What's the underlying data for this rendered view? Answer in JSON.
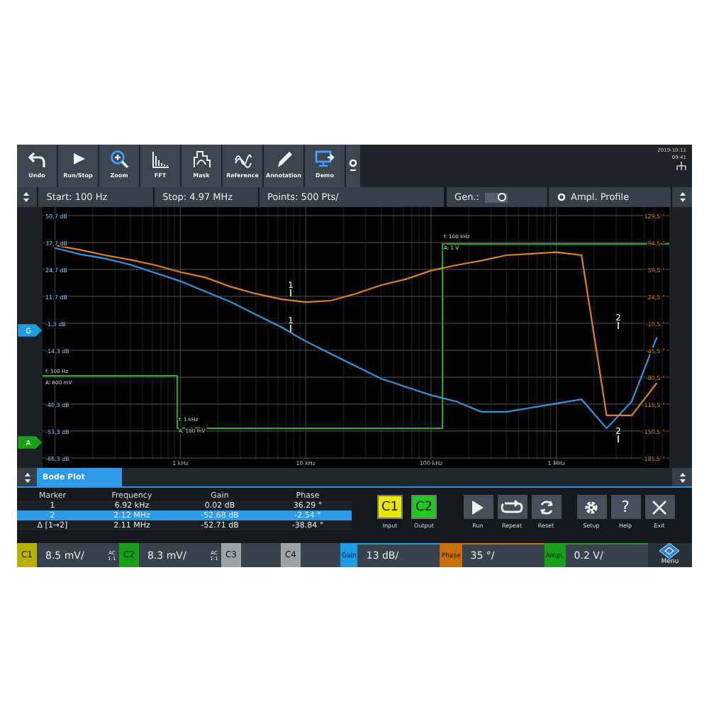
{
  "toolbar": {
    "buttons": [
      {
        "label": "Undo",
        "kind": "undo"
      },
      {
        "label": "Run/Stop",
        "kind": "play"
      },
      {
        "label": "Zoom",
        "kind": "zoom"
      },
      {
        "label": "FFT",
        "kind": "fft"
      },
      {
        "label": "Mask",
        "kind": "mask"
      },
      {
        "label": "Reference",
        "kind": "reference"
      },
      {
        "label": "Annotation",
        "kind": "pencil"
      },
      {
        "label": "Demo",
        "kind": "demo"
      }
    ],
    "date": "2019-10-11",
    "time": "09:41"
  },
  "sweep": {
    "start": "Start: 100 Hz",
    "stop": "Stop: 4.97 MHz",
    "points": "Points: 500 Pts/",
    "generator": {
      "label": "Gen.:",
      "on": true
    },
    "profile": {
      "label": "Ampl. Profile"
    }
  },
  "plot": {
    "chart_data": {
      "type": "line",
      "grid": true,
      "categories": [
        null,
        null,
        null,
        null,
        null,
        "1 kHz",
        null,
        null,
        null,
        null,
        "10 kHz",
        null,
        null,
        null,
        null,
        "100 kHz",
        null,
        null,
        null,
        null,
        "1 MHz",
        null,
        null,
        null,
        null
      ],
      "ylim": [
        -66.3,
        50.7
      ],
      "yticks": [
        {
          "value": 50.7,
          "label": "50,7 dB"
        },
        {
          "value": 37.7,
          "label": "37,7 dB"
        },
        {
          "value": 24.7,
          "label": "24,7 dB"
        },
        {
          "value": 11.7,
          "label": "11,7 dB"
        },
        {
          "value": -1.3,
          "label": "-1,3 dB"
        },
        {
          "value": -14.3,
          "label": "-14,3 dB"
        },
        {
          "value": -40.3,
          "label": "-40,3 dB"
        },
        {
          "value": -53.3,
          "label": "-53,3 dB"
        },
        {
          "value": -66.3,
          "label": "-66,3 dB"
        }
      ],
      "y2lim": [
        -185.5,
        129.5
      ],
      "y2ticks": [
        {
          "value": 129.5,
          "label": "129,5 °"
        },
        {
          "value": 94.5,
          "label": "94,5 °"
        },
        {
          "value": 59.5,
          "label": "59,5 °"
        },
        {
          "value": 24.5,
          "label": "24,5 °"
        },
        {
          "value": -10.5,
          "label": "-10,5 °"
        },
        {
          "value": -45.5,
          "label": "-45,5 °"
        },
        {
          "value": -80.5,
          "label": "-80,5 °"
        },
        {
          "value": -115.5,
          "label": "-115,5 °"
        },
        {
          "value": -150.5,
          "label": "-150,5 °"
        },
        {
          "value": -185.5,
          "label": "-185,5 °"
        }
      ],
      "series": [
        {
          "color": "#2a98e0",
          "values": [
            35,
            32,
            30,
            27,
            23,
            19,
            14,
            9,
            3,
            -3,
            -10,
            -16,
            -22,
            -28,
            -32,
            -36,
            -39,
            -44,
            -44,
            -42,
            -40,
            -38,
            -52,
            -39,
            -8
          ]
        },
        {
          "color": "#e0801c",
          "axis": "y2",
          "values": [
            91,
            85,
            78,
            72,
            65,
            56,
            49,
            37,
            28,
            21,
            17,
            19,
            28,
            39,
            47,
            58,
            65,
            71,
            78,
            80,
            82,
            78,
            -130,
            -130,
            -88
          ]
        }
      ]
    },
    "profile_labels": [
      {
        "lines": [
          "f: 100 Hz",
          "A: 600 mV"
        ]
      },
      {
        "lines": [
          "f: 1 kHz",
          "A: 100 mV"
        ]
      },
      {
        "lines": [
          "f: 100 kHz",
          "A: 1 V"
        ]
      }
    ],
    "markers": [
      {
        "label": "1"
      },
      {
        "label": "1"
      },
      {
        "label": "2"
      },
      {
        "label": "2"
      }
    ],
    "tags": [
      {
        "label": "G",
        "color": "#1e9be0"
      },
      {
        "label": "A",
        "color": "#19a019"
      }
    ]
  },
  "panel": {
    "tab": {
      "label": "Bode Plot",
      "selected": true
    },
    "table": {
      "columns": [
        "Marker",
        "Frequency",
        "Gain",
        "Phase"
      ],
      "rows": [
        {
          "cells": [
            "1",
            "6.92 kHz",
            "0.02 dB",
            "36.29 °"
          ],
          "selected": false
        },
        {
          "cells": [
            "2",
            "2.12 MHz",
            "-52.68 dB",
            "-2.54 °"
          ],
          "selected": true
        },
        {
          "cells": [
            "Δ [1→2]",
            "2.11 MHz",
            "-52.71 dB",
            "-38.84 °"
          ],
          "selected": false
        }
      ]
    },
    "buttons": [
      {
        "kind": "channel",
        "chip": "C1",
        "label": "Input",
        "color": "#e8e800"
      },
      {
        "kind": "channel",
        "chip": "C2",
        "label": "Output",
        "color": "#22c822"
      },
      {
        "kind": "run",
        "label": "Run"
      },
      {
        "kind": "repeat",
        "label": "Repeat"
      },
      {
        "kind": "reset",
        "label": "Reset"
      },
      {
        "kind": "setup",
        "label": "Setup"
      },
      {
        "kind": "help",
        "label": "Help",
        "glyph": "?"
      },
      {
        "kind": "exit",
        "label": "Exit"
      }
    ]
  },
  "channels": [
    {
      "name": "C1",
      "on": true,
      "color": "#b8b000",
      "scale": "8.5 mV/",
      "coupling": "AC",
      "ratio": "1:1"
    },
    {
      "name": "C2",
      "on": true,
      "color": "#19a019",
      "scale": "8.3 mV/",
      "coupling": "AC",
      "ratio": "1:1"
    },
    {
      "name": "C3",
      "on": false,
      "color": "#9ea3a8"
    },
    {
      "name": "C4",
      "on": false,
      "color": "#9ea3a8"
    }
  ],
  "scales": [
    {
      "name": "Gain",
      "value": "13 dB/",
      "color": "#1e9be0"
    },
    {
      "name": "Phase",
      "value": "35 °/",
      "color": "#c8700c"
    },
    {
      "name": "Ampl.",
      "value": "0.2 V/",
      "color": "#19a019"
    }
  ],
  "menu": {
    "label": "Menu"
  }
}
